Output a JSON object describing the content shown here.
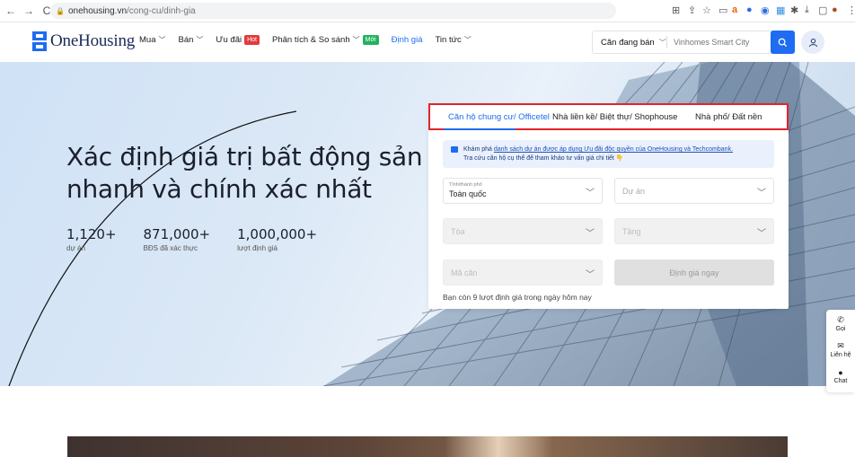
{
  "browser": {
    "url_domain": "onehousing.vn",
    "url_path": "/cong-cu/dinh-gia",
    "nav": {
      "back": "←",
      "forward": "→",
      "reload": "C"
    }
  },
  "header": {
    "logo_text": "OneHousing",
    "menu": [
      {
        "label": "Mua",
        "chevron": true
      },
      {
        "label": "Bán",
        "chevron": true
      },
      {
        "label": "Ưu đãi",
        "badge": "Hot"
      },
      {
        "label": "Phân tích & So sánh",
        "chevron": true,
        "badge": "Mới"
      },
      {
        "label": "Định giá",
        "active": true
      },
      {
        "label": "Tin tức",
        "chevron": true
      }
    ],
    "search": {
      "type_label": "Căn đang bán",
      "placeholder": "Vinhomes Smart City"
    }
  },
  "hero": {
    "title_line1": "Xác định giá trị bất động sản",
    "title_line2": "nhanh và chính xác nhất",
    "stats": [
      {
        "value": "1,120+",
        "label": "dự án"
      },
      {
        "value": "871,000+",
        "label": "BĐS đã xác thực"
      },
      {
        "value": "1,000,000+",
        "label": "lượt định giá"
      }
    ]
  },
  "form": {
    "tabs": [
      {
        "label": "Căn hộ chung cư/ Officetel",
        "active": true
      },
      {
        "label": "Nhà liền kề/ Biệt thự/ Shophouse",
        "active": false
      },
      {
        "label": "Nhà phố/ Đất nền",
        "active": false
      }
    ],
    "notice": {
      "prefix": "Khám phá ",
      "link": "danh sách dự án được áp dụng Ưu đãi độc quyền của OneHousing và Techcombank.",
      "line2": "Tra cứu căn hộ cụ thể để tham khảo tư vấn giá chi tiết 👇"
    },
    "city_label": "Tỉnh/thành phố",
    "city_value": "Toàn quốc",
    "project_placeholder": "Dự án",
    "building_placeholder": "Tòa",
    "floor_placeholder": "Tầng",
    "unit_placeholder": "Mã căn",
    "submit_label": "Định giá ngay",
    "remaining_text": "Bạn còn 9 lượt định giá trong ngày hôm nay"
  },
  "side_widget": [
    {
      "label": "Gọi",
      "icon": "phone-icon"
    },
    {
      "label": "Liên hệ",
      "icon": "contact-icon"
    },
    {
      "label": "Chat",
      "icon": "chat-icon"
    }
  ],
  "colors": {
    "brand_blue": "#1e6cf2",
    "highlight_red": "#e2242b",
    "badge_hot": "#e23b3b",
    "badge_new": "#22b35e"
  }
}
